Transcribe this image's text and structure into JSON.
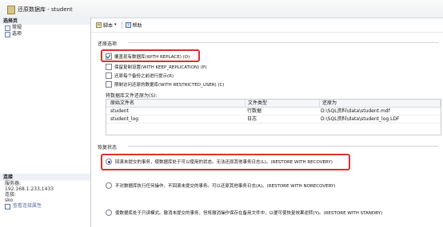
{
  "window": {
    "title": "还原数据库 - student"
  },
  "left_pane": {
    "header": "选择页",
    "items": [
      {
        "label": "常规"
      },
      {
        "label": "选项"
      }
    ],
    "connection": {
      "header": "连接",
      "server_label": "服务器:",
      "server_value": "192.168.1.233,1433",
      "conn_label": "连接:",
      "conn_value": "sko",
      "link_label": "查看连接属性"
    }
  },
  "toolbar": {
    "script_label": "脚本",
    "help_label": "帮助"
  },
  "restore_options": {
    "title": "还原选项",
    "options": [
      {
        "label": "覆盖现有数据库(WITH REPLACE) (O)",
        "checked": true
      },
      {
        "label": "保留复制设置(WITH KEEP_REPLICATION) (P)",
        "checked": false
      },
      {
        "label": "还原每个备份之前进行提示(R)",
        "checked": false
      },
      {
        "label": "限制访问还原的数据库(WITH RESTRICTED_USER) (C)",
        "checked": false
      }
    ],
    "files_caption": "将数据库文件还原为(S):",
    "grid": {
      "headers": [
        "原始文件名",
        "文件类型",
        "还原为"
      ],
      "rows": [
        [
          "student",
          "行数据",
          "D:\\SQL资料\\data\\student.mdf"
        ],
        [
          "student_log",
          "日志",
          "D:\\SQL资料\\data\\student_log.LDF"
        ]
      ]
    }
  },
  "recovery_state": {
    "title": "恢复状态",
    "options": [
      {
        "label": "回滚未提交的事务，使数据库处于可以使用的状态。无法还原其他事务日志(L)。(RESTORE WITH RECOVERY)",
        "checked": true
      },
      {
        "label": "不对数据库执行任何操作，不回滚未提交的事务。可以还原其他事务日志(A)。(RESTORE WITH NORECOVERY)",
        "checked": false
      },
      {
        "label": "使数据库处于只读模式。撤消未提交的事务，但将撤消操作保存在备用文件中，以便可使恢复效果逆转(Y)。(RESTORE WITH STANDBY)",
        "checked": false
      }
    ]
  },
  "colors": {
    "highlight": "#d9332e",
    "accent": "#1c3f9c"
  }
}
